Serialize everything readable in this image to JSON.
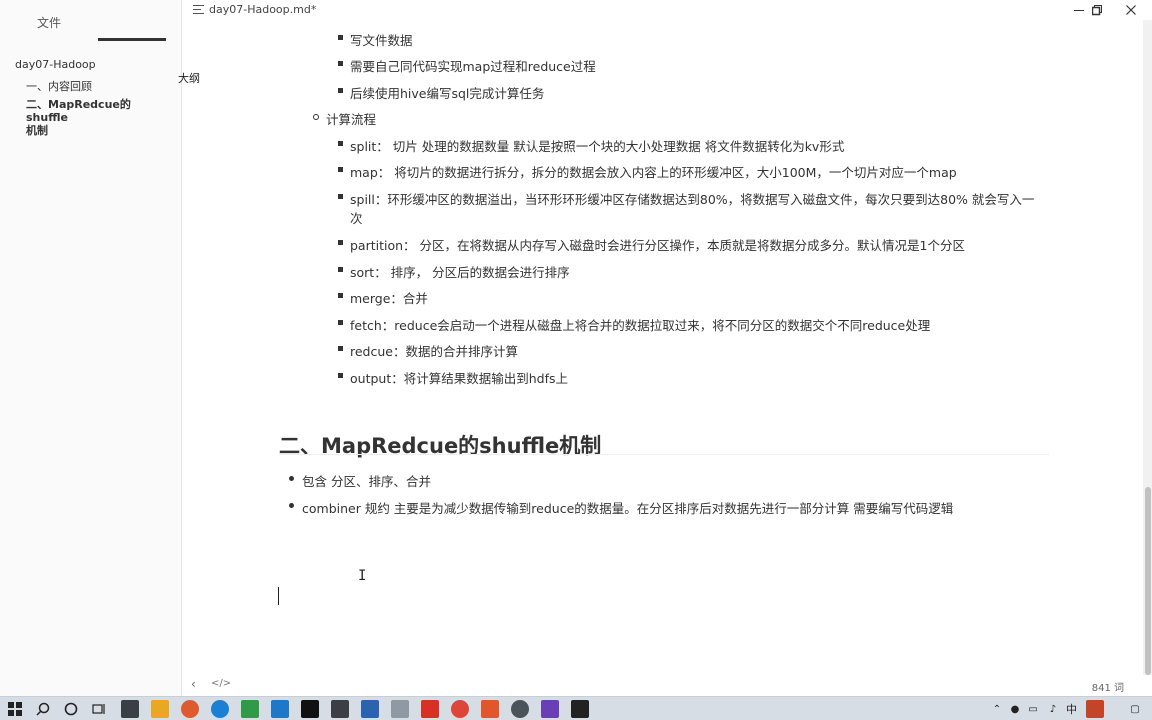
{
  "window": {
    "title": "day07-Hadoop.md*",
    "minimize_label": "minimize",
    "maximize_label": "restore",
    "close_label": "close"
  },
  "sidebar": {
    "tabs": [
      {
        "label": "文件"
      },
      {
        "label": "大纲"
      }
    ],
    "outline": [
      {
        "label": "day07-Hadoop"
      },
      {
        "label": "一、内容回顾"
      },
      {
        "label": "二、MapRedcue的shuffle"
      },
      {
        "label": "机制"
      }
    ]
  },
  "editor": {
    "lines": [
      "写文件数据",
      "需要自己同代码实现map过程和reduce过程",
      "后续使用hive编写sql完成计算任务",
      "计算流程",
      "split： 切片   处理的数据数量   默认是按照一个块的大小处理数据  将文件数据转化为kv形式",
      "map： 将切片的数据进行拆分，拆分的数据会放入内容上的环形缓冲区，大小100M，一个切片对应一个map",
      "spill：环形缓冲区的数据溢出，当环形环形缓冲区存储数据达到80%，将数据写入磁盘文件，每次只要到达80% 就会写入一",
      "次",
      "partition： 分区，在将数据从内存写入磁盘时会进行分区操作，本质就是将数据分成多分。默认情况是1个分区",
      "sort： 排序， 分区后的数据会进行排序",
      "merge：合并",
      "fetch：reduce会启动一个进程从磁盘上将合并的数据拉取过来，将不同分区的数据交个不同reduce处理",
      "redcue：数据的合并排序计算",
      "output：将计算结果数据输出到hdfs上"
    ],
    "heading": "二、MapRedcue的shuffle机制",
    "section_items": [
      "包含  分区、排序、合并",
      "combiner 规约   主要是为减少数据传输到reduce的数据量。在分区排序后对数据先进行一部分计算   需要编写代码逻辑"
    ]
  },
  "status": {
    "back_label": "‹",
    "source_label": "</>",
    "word_count": "841 词"
  },
  "taskbar": {
    "ime": "中"
  }
}
